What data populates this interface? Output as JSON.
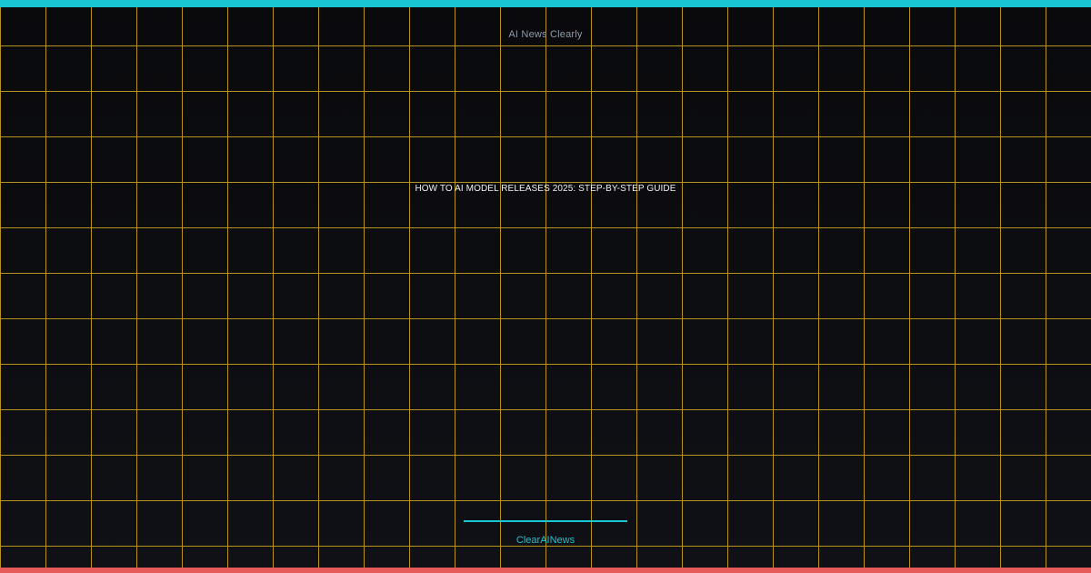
{
  "brand": {
    "name": "AI News Clearly"
  },
  "headline": {
    "text": "HOW TO AI MODEL RELEASES 2025: STEP-BY-STEP GUIDE"
  },
  "footer": {
    "handle": "ClearAINews"
  },
  "colors": {
    "accent": "#19c5d3",
    "accent_bottom": "#e65a5a",
    "grid": "#c9a21c",
    "background": "#0b0c10"
  }
}
